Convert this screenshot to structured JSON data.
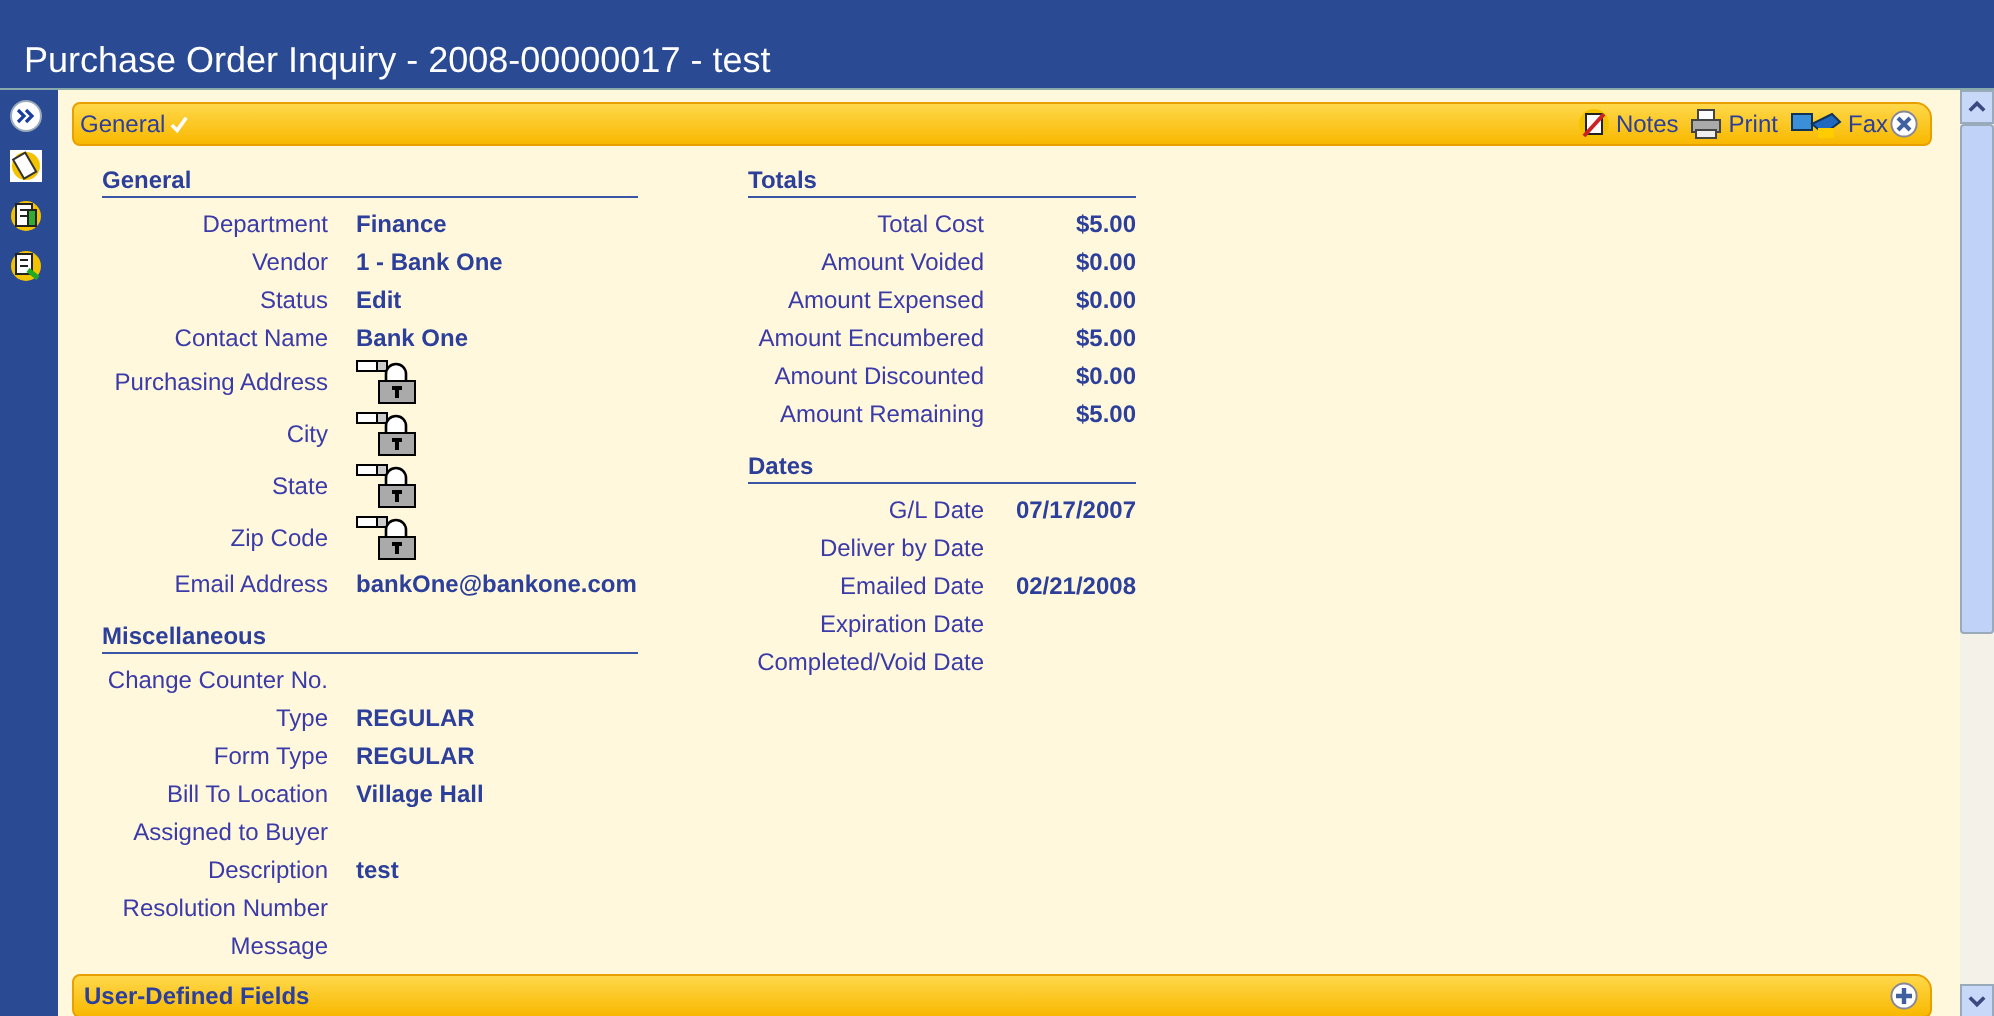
{
  "window": {
    "title": "Purchase Order Inquiry - 2008-00000017 - test"
  },
  "panel": {
    "title": "General",
    "checked": true,
    "actions": [
      {
        "kind": "notes",
        "label": "Notes"
      },
      {
        "kind": "print",
        "label": "Print"
      },
      {
        "kind": "fax",
        "label": "Fax"
      }
    ]
  },
  "general": {
    "heading": "General",
    "rows": [
      {
        "label": "Department",
        "kind": "text",
        "value": "Finance"
      },
      {
        "label": "Vendor",
        "kind": "text",
        "value": "1 - Bank One"
      },
      {
        "label": "Status",
        "kind": "text",
        "value": "Edit"
      },
      {
        "label": "Contact Name",
        "kind": "text",
        "value": "Bank One"
      },
      {
        "label": "Purchasing Address",
        "kind": "locked"
      },
      {
        "label": "City",
        "kind": "locked"
      },
      {
        "label": "State",
        "kind": "locked"
      },
      {
        "label": "Zip Code",
        "kind": "locked"
      },
      {
        "label": "Email Address",
        "kind": "text",
        "value": "bankOne@bankone.com"
      }
    ]
  },
  "miscellaneous": {
    "heading": "Miscellaneous",
    "rows": [
      {
        "label": "Change Counter No.",
        "kind": "text"
      },
      {
        "label": "Type",
        "kind": "text",
        "value": "REGULAR"
      },
      {
        "label": "Form Type",
        "kind": "text",
        "value": "REGULAR"
      },
      {
        "label": "Bill To Location",
        "kind": "text",
        "value": "Village Hall"
      },
      {
        "label": "Assigned to Buyer",
        "kind": "text"
      },
      {
        "label": "Description",
        "kind": "text",
        "value": "test"
      },
      {
        "label": "Resolution Number",
        "kind": "text"
      },
      {
        "label": "Message",
        "kind": "text"
      }
    ]
  },
  "totals": {
    "heading": "Totals",
    "rows": [
      {
        "label": "Total Cost",
        "value": "$5.00"
      },
      {
        "label": "Amount Voided",
        "value": "$0.00"
      },
      {
        "label": "Amount Expensed",
        "value": "$0.00"
      },
      {
        "label": "Amount Encumbered",
        "value": "$5.00"
      },
      {
        "label": "Amount Discounted",
        "value": "$0.00"
      },
      {
        "label": "Amount Remaining",
        "value": "$5.00"
      }
    ]
  },
  "dates": {
    "heading": "Dates",
    "rows": [
      {
        "label": "G/L Date",
        "value": "07/17/2007"
      },
      {
        "label": "Deliver by Date"
      },
      {
        "label": "Emailed Date",
        "value": "02/21/2008"
      },
      {
        "label": "Expiration Date"
      },
      {
        "label": "Completed/Void Date"
      }
    ]
  },
  "user_defined": {
    "title": "User-Defined Fields",
    "expanded": false
  }
}
